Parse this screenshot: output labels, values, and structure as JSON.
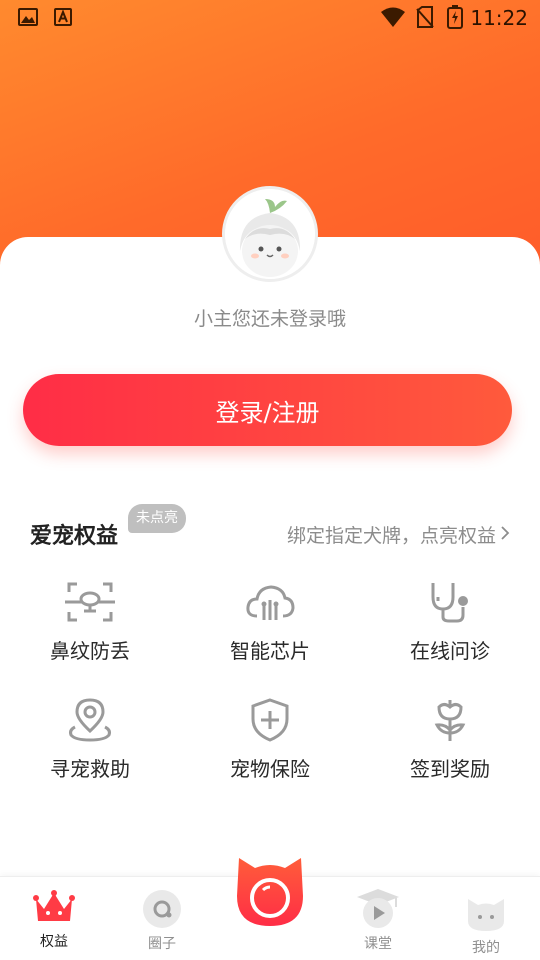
{
  "status_bar": {
    "time": "11:22",
    "icons": [
      "image-icon",
      "text-a-icon",
      "wifi-icon",
      "no-sim-icon",
      "battery-charging-icon"
    ]
  },
  "profile": {
    "avatar_icon": "mascot-avatar-icon",
    "login_hint": "小主您还未登录哦"
  },
  "login_button": {
    "label": "登录/注册"
  },
  "benefits": {
    "title": "爱宠权益",
    "badge": "未点亮",
    "link_text": "绑定指定犬牌，点亮权益",
    "items": [
      {
        "label": "鼻纹防丢",
        "icon": "nose-scan-icon"
      },
      {
        "label": "智能芯片",
        "icon": "cloud-chip-icon"
      },
      {
        "label": "在线问诊",
        "icon": "stethoscope-icon"
      },
      {
        "label": "寻宠救助",
        "icon": "location-pin-icon"
      },
      {
        "label": "宠物保险",
        "icon": "shield-plus-icon"
      },
      {
        "label": "签到奖励",
        "icon": "flower-icon"
      }
    ]
  },
  "tabbar": {
    "tabs": [
      {
        "label": "权益",
        "icon": "crown-icon",
        "active": true
      },
      {
        "label": "圈子",
        "icon": "circle-chat-icon",
        "active": false
      },
      {
        "label": "",
        "icon": "cat-camera-icon",
        "active": false
      },
      {
        "label": "课堂",
        "icon": "graduation-play-icon",
        "active": false
      },
      {
        "label": "我的",
        "icon": "cat-face-icon",
        "active": false
      }
    ]
  },
  "colors": {
    "hero_start": "#ff8a2e",
    "hero_end": "#ff5a2a",
    "button_start": "#ff2d46",
    "button_end": "#ff5a3c",
    "icon_gray": "#9a9a9a"
  }
}
